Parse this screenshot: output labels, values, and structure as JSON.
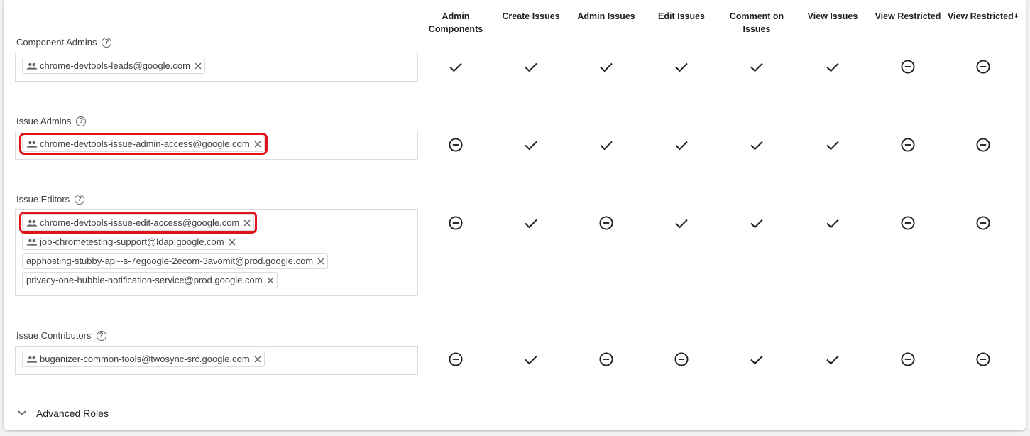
{
  "columns": [
    "Admin Components",
    "Create Issues",
    "Admin Issues",
    "Edit Issues",
    "Comment on Issues",
    "View Issues",
    "View Restricted",
    "View Restricted+"
  ],
  "roles": [
    {
      "label": "Component Admins",
      "members": [
        {
          "name": "chrome-devtools-leads@google.com",
          "group": true,
          "highlighted": false
        }
      ],
      "permissions": [
        "check",
        "check",
        "check",
        "check",
        "check",
        "check",
        "minus",
        "minus"
      ]
    },
    {
      "label": "Issue Admins",
      "members": [
        {
          "name": "chrome-devtools-issue-admin-access@google.com",
          "group": true,
          "highlighted": true
        }
      ],
      "permissions": [
        "minus",
        "check",
        "check",
        "check",
        "check",
        "check",
        "minus",
        "minus"
      ]
    },
    {
      "label": "Issue Editors",
      "members": [
        {
          "name": "chrome-devtools-issue-edit-access@google.com",
          "group": true,
          "highlighted": true
        },
        {
          "name": "job-chrometesting-support@ldap.google.com",
          "group": true,
          "highlighted": false
        },
        {
          "name": "apphosting-stubby-api--s-7egoogle-2ecom-3avomit@prod.google.com",
          "group": false,
          "highlighted": false
        },
        {
          "name": "privacy-one-hubble-notification-service@prod.google.com",
          "group": false,
          "highlighted": false
        }
      ],
      "permissions": [
        "minus",
        "check",
        "minus",
        "check",
        "check",
        "check",
        "minus",
        "minus"
      ]
    },
    {
      "label": "Issue Contributors",
      "members": [
        {
          "name": "buganizer-common-tools@twosync-src.google.com",
          "group": true,
          "highlighted": false
        }
      ],
      "permissions": [
        "minus",
        "check",
        "minus",
        "minus",
        "check",
        "check",
        "minus",
        "minus"
      ]
    }
  ],
  "advanced_roles_label": "Advanced Roles",
  "help_icon": "?",
  "icons": {
    "check": "check-icon",
    "minus": "minus-circle-icon",
    "group": "group-icon",
    "remove": "close-icon",
    "expand": "chevron-down-icon"
  },
  "colors": {
    "highlight": "#e0121a",
    "icon": "#202124",
    "border": "#dadce0"
  }
}
